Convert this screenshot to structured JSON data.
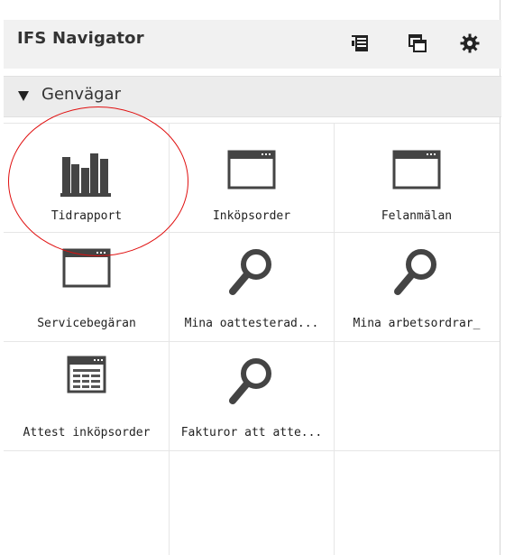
{
  "panel": {
    "title": "IFS Navigator",
    "toolbar_icons": [
      "list-icon",
      "windows-icon",
      "gear-icon"
    ]
  },
  "section": {
    "label": "Genvägar",
    "expanded": true
  },
  "tiles": [
    {
      "label": "Tidrapport",
      "icon": "bar-chart-icon",
      "highlighted": true
    },
    {
      "label": "Inköpsorder",
      "icon": "window-icon"
    },
    {
      "label": "Felanmälan",
      "icon": "window-icon"
    },
    {
      "label": "Servicebegäran",
      "icon": "window-icon"
    },
    {
      "label": "Mina oattesterad...",
      "icon": "search-icon"
    },
    {
      "label": "Mina arbetsordrar_",
      "icon": "search-icon"
    },
    {
      "label": "Attest inköpsorder",
      "icon": "table-window-icon"
    },
    {
      "label": "Fakturor att atte...",
      "icon": "search-icon"
    }
  ],
  "colors": {
    "highlight_circle": "#e01010",
    "icon_dark": "#444444",
    "header_bg": "#f1f1f1"
  }
}
